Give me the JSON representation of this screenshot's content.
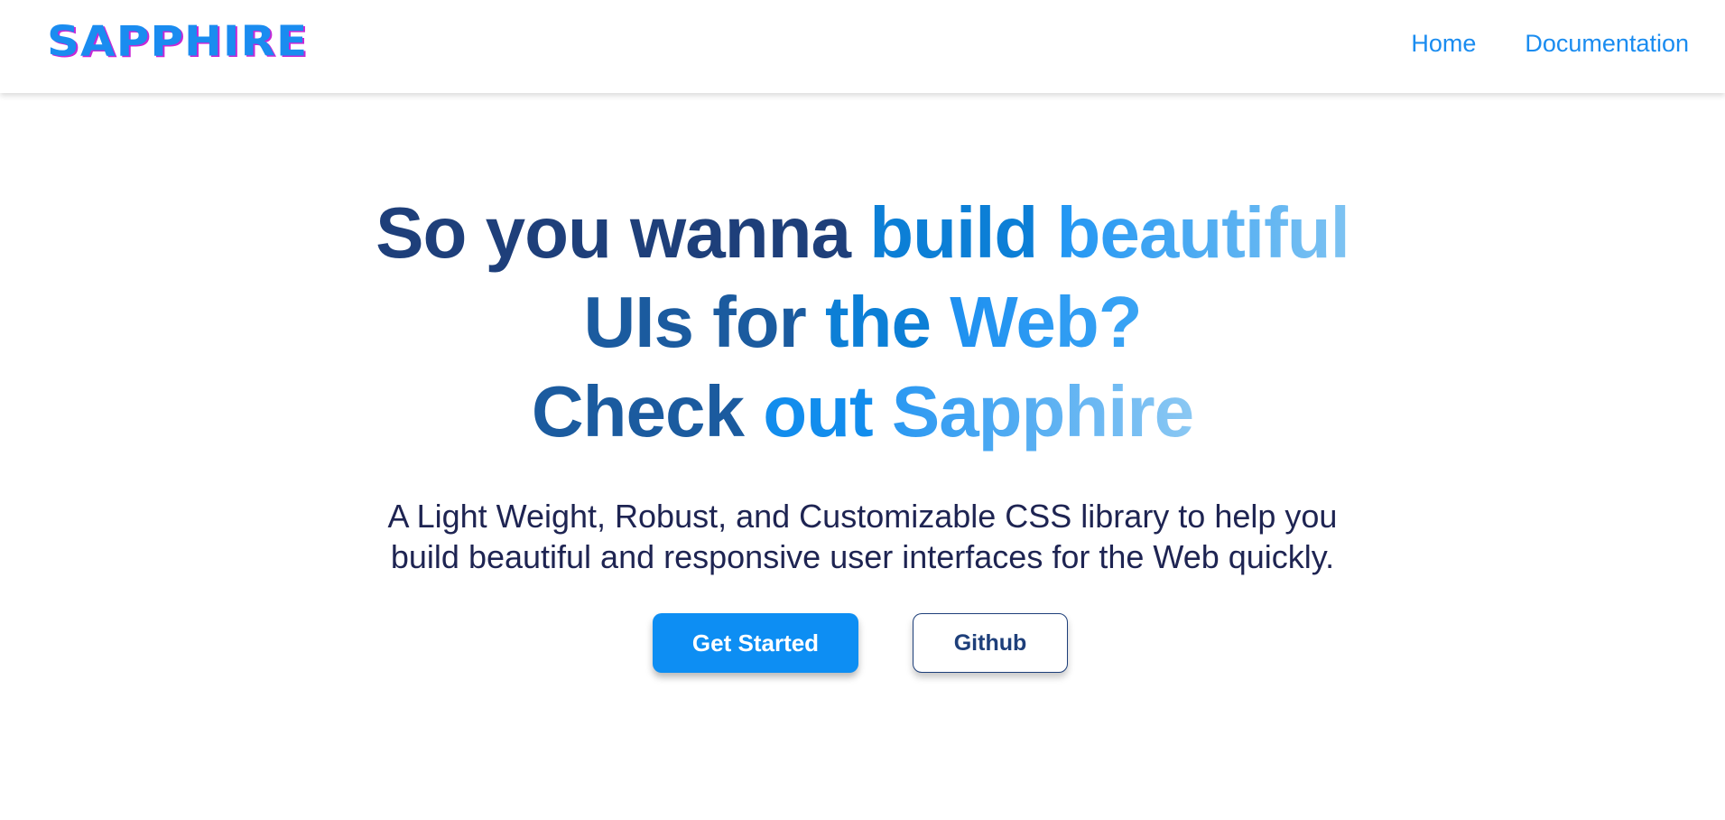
{
  "brand": {
    "logo_text": "SAPPHIRE",
    "primary_color": "#1a8cf0",
    "logo_shadow_color": "#c728d6"
  },
  "nav": {
    "items": [
      {
        "label": "Home"
      },
      {
        "label": "Documentation"
      }
    ]
  },
  "hero": {
    "headline": {
      "line1": {
        "part1": "So you wanna",
        "part2": "build",
        "part3": "beautiful"
      },
      "line2": {
        "part1": "UIs for",
        "part2": "the",
        "part3": "Web?"
      },
      "line3": {
        "part1": "Check",
        "part2": "out",
        "part3": "Sapphire"
      }
    },
    "subtitle_line1": "A Light Weight, Robust, and Customizable CSS library to help you",
    "subtitle_line2": "build beautiful and responsive user interfaces for the Web quickly.",
    "buttons": {
      "primary": "Get Started",
      "secondary": "Github"
    }
  },
  "colors": {
    "navy": "#1e3f7a",
    "text_dark": "#1e2452",
    "button_blue": "#0d8ef3"
  }
}
